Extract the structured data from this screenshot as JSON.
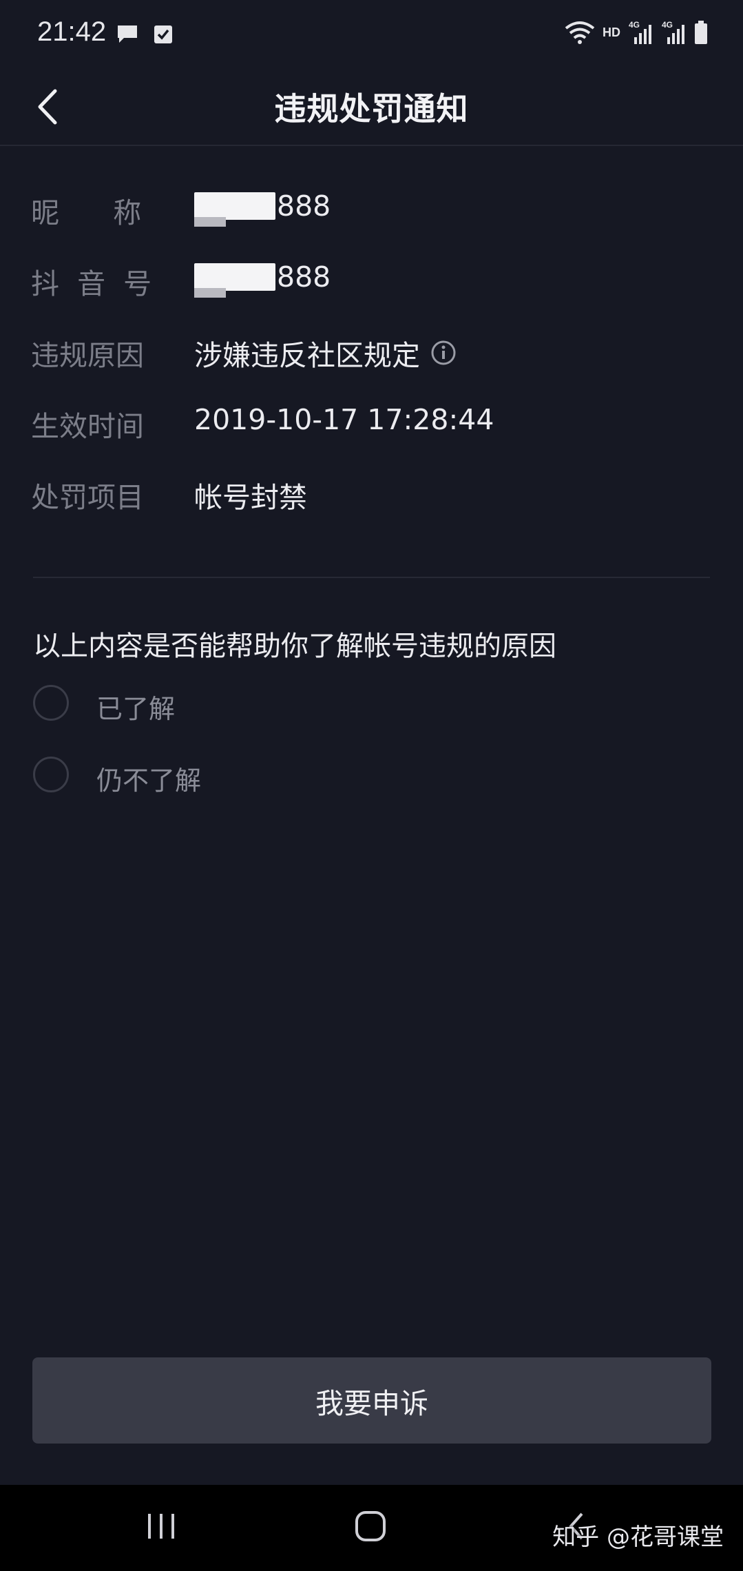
{
  "status_bar": {
    "time": "21:42",
    "hd_label": "HD",
    "network_label": "4G",
    "icons": [
      "chat-icon",
      "check-icon",
      "wifi-icon",
      "signal-icon",
      "signal-icon",
      "battery-icon"
    ]
  },
  "header": {
    "title": "违规处罚通知",
    "back_icon": "chevron-left-icon"
  },
  "info": {
    "nickname_label": "昵      称",
    "nickname_value_suffix": "888",
    "douyin_id_label": "抖  音  号",
    "douyin_id_value_suffix": "888",
    "reason_label": "违规原因",
    "reason_value": "涉嫌违反社区规定",
    "effective_time_label": "生效时间",
    "effective_time_value": "2019-10-17 17:28:44",
    "penalty_label": "处罚项目",
    "penalty_value": "帐号封禁"
  },
  "survey": {
    "question": "以上内容是否能帮助你了解帐号违规的原因",
    "options": [
      {
        "label": "已了解",
        "selected": false
      },
      {
        "label": "仍不了解",
        "selected": false
      }
    ]
  },
  "appeal_button": "我要申诉",
  "watermark": "知乎 @花哥课堂",
  "colors": {
    "background": "#161823",
    "button": "#393b47",
    "label": "#7c7e89"
  }
}
